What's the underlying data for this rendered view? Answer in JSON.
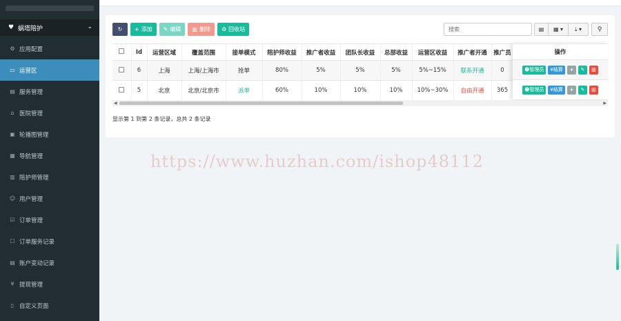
{
  "sidebar": {
    "group_label": "蜗塔陪护",
    "items": [
      {
        "icon": "gear-icon",
        "glyph": "⚙",
        "label": "应用配置",
        "active": false
      },
      {
        "icon": "map-icon",
        "glyph": "▭",
        "label": "运营区",
        "active": true
      },
      {
        "icon": "service-icon",
        "glyph": "▤",
        "label": "服务管理",
        "active": false
      },
      {
        "icon": "hospital-icon",
        "glyph": "⌂",
        "label": "医院管理",
        "active": false
      },
      {
        "icon": "image-icon",
        "glyph": "▣",
        "label": "轮播图管理",
        "active": false
      },
      {
        "icon": "nav-icon",
        "glyph": "▦",
        "label": "导航管理",
        "active": false
      },
      {
        "icon": "escort-icon",
        "glyph": "▥",
        "label": "陪护师管理",
        "active": false
      },
      {
        "icon": "user-icon",
        "glyph": "☺",
        "label": "用户管理",
        "active": false
      },
      {
        "icon": "order-icon",
        "glyph": "☑",
        "label": "订单管理",
        "active": false
      },
      {
        "icon": "order-log-icon",
        "glyph": "☐",
        "label": "订单服务记录",
        "active": false
      },
      {
        "icon": "account-icon",
        "glyph": "▤",
        "label": "账户变动记录",
        "active": false
      },
      {
        "icon": "yen-icon",
        "glyph": "¥",
        "label": "提现管理",
        "active": false
      },
      {
        "icon": "page-icon",
        "glyph": "▯",
        "label": "自定义页面",
        "active": false
      }
    ]
  },
  "toolbar": {
    "add_label": "添加",
    "edit_label": "编辑",
    "delete_label": "删除",
    "recycle_label": "回收站",
    "search_placeholder": "搜索"
  },
  "table": {
    "columns": [
      "Id",
      "运营区域",
      "覆盖范围",
      "接单模式",
      "陪护师收益",
      "推广者收益",
      "团队长收益",
      "总部收益",
      "运营区收益",
      "推广者开通",
      "推广员"
    ],
    "ops_header": "操作",
    "rows": [
      {
        "id": "6",
        "area": "上海",
        "range": "上海/上海市",
        "mode": "抢单",
        "mode_color": "normal",
        "escort": "80%",
        "promoter": "5%",
        "leader": "5%",
        "hq": "5%",
        "region": "5%~15%",
        "open": "联系开通",
        "open_color": "green",
        "last": "0"
      },
      {
        "id": "5",
        "area": "北京",
        "range": "北京/北京市",
        "mode": "派单",
        "mode_color": "green",
        "escort": "60%",
        "promoter": "10%",
        "leader": "10%",
        "hq": "10%",
        "region": "10%~30%",
        "open": "自由开通",
        "open_color": "red",
        "last": "365"
      }
    ],
    "op_manager": "管理员",
    "op_settle": "结算"
  },
  "pagination_info": "显示第 1 到第 2 条记录，总共 2 条记录",
  "watermark": "https://www.huzhan.com/ishop48112",
  "colors": {
    "sidebar": "#222d32",
    "active": "#3c8dbc",
    "success": "#18bc9c",
    "danger": "#e74c3c",
    "info": "#3498db"
  }
}
